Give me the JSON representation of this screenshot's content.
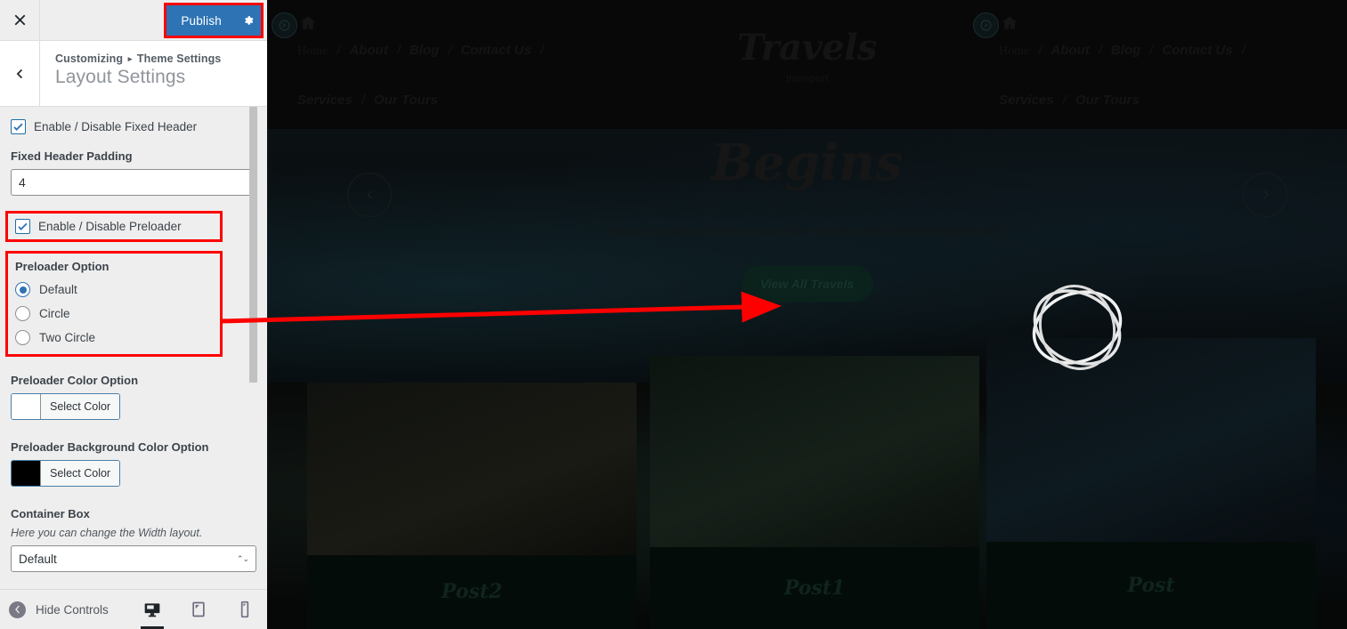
{
  "customizer": {
    "topbar": {
      "close_icon": "close-icon",
      "publish_label": "Publish",
      "gear_icon": "gear-icon",
      "publish_highlight_color": "#ff0000",
      "publish_bg_color": "#2e74b5"
    },
    "panel": {
      "back_icon": "chevron-left-icon",
      "breadcrumb_root": "Customizing",
      "breadcrumb_caret": "▸",
      "breadcrumb_parent": "Theme Settings",
      "title": "Layout Settings"
    },
    "controls": {
      "fixed_header_checkbox": {
        "label": "Enable / Disable Fixed Header",
        "checked": true
      },
      "fixed_header_padding": {
        "label": "Fixed Header Padding",
        "value": "4",
        "placeholder": ""
      },
      "preloader_checkbox": {
        "label": "Enable / Disable Preloader",
        "checked": true,
        "highlighted": true
      },
      "preloader_option": {
        "label": "Preloader Option",
        "highlighted": true,
        "selected": "Default",
        "options": [
          {
            "label": "Default",
            "selected": true
          },
          {
            "label": "Circle",
            "selected": false
          },
          {
            "label": "Two Circle",
            "selected": false
          }
        ]
      },
      "preloader_color": {
        "label": "Preloader Color Option",
        "button_label": "Select Color",
        "swatch": "#ffffff"
      },
      "preloader_bg_color": {
        "label": "Preloader Background Color Option",
        "button_label": "Select Color",
        "swatch": "#000000"
      },
      "container_box": {
        "label": "Container Box",
        "description": "Here you can change the Width layout.",
        "value": "Default"
      }
    },
    "footer": {
      "collapse_label": "Hide Controls",
      "collapse_icon": "chevron-left-circle-icon",
      "devices": [
        {
          "name": "desktop",
          "icon": "desktop-icon",
          "active": true
        },
        {
          "name": "tablet",
          "icon": "tablet-icon",
          "active": false
        },
        {
          "name": "mobile",
          "icon": "mobile-icon",
          "active": false
        }
      ]
    }
  },
  "preview": {
    "header": {
      "scroll_icon": "scroll-down-icon",
      "home_icon": "home-icon",
      "nav_primary": [
        "Home",
        "About",
        "Blog",
        "Contact Us"
      ],
      "nav_secondary": [
        "Services",
        "Our Tours"
      ],
      "separator": "/",
      "brand_name": "Travels",
      "brand_tagline": "transport"
    },
    "hero": {
      "title": "Begins",
      "subtitle": "loream is simply dummy text of the printing and typesetting industry.",
      "button_label": "View All Travels",
      "prev_icon": "chevron-left-icon",
      "next_icon": "chevron-right-icon"
    },
    "cards": [
      {
        "title": "Post2"
      },
      {
        "title": "Post1"
      },
      {
        "title": "Post"
      }
    ],
    "preloader": {
      "icon": "preloader-spinner-icon",
      "color": "#ffffff"
    }
  },
  "annotation": {
    "arrow_color": "#ff0000",
    "arrow_from": "preloader-option-box",
    "arrow_to": "preloader-spinner"
  }
}
